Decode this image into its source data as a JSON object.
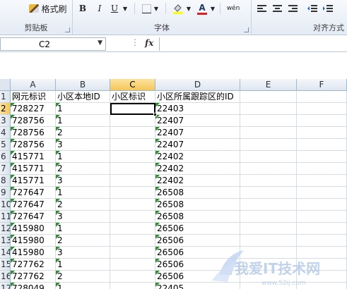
{
  "ribbon": {
    "format_painter_label": "格式刷",
    "bold": "B",
    "italic": "I",
    "underline": "U",
    "font_color_letter": "A",
    "phonetic_label": "wén",
    "groups": {
      "clipboard": "剪贴板",
      "font": "字体",
      "alignment": "对齐方式"
    }
  },
  "formula_bar": {
    "name_box": "C2",
    "fx_label": "fx",
    "formula": ""
  },
  "columns": [
    "A",
    "B",
    "C",
    "D",
    "E",
    "F"
  ],
  "selected_column": "C",
  "selected_row": "2",
  "row_numbers": [
    "1",
    "2",
    "3",
    "4",
    "5",
    "6",
    "7",
    "8",
    "9",
    "10",
    "11",
    "12",
    "13",
    "14",
    "15",
    "16",
    "17"
  ],
  "headers": [
    "网元标识",
    "小区本地ID",
    "小区标识",
    "小区所属跟踪区的ID"
  ],
  "rows": [
    [
      "728227",
      "1",
      "",
      "22403"
    ],
    [
      "728756",
      "1",
      "",
      "22407"
    ],
    [
      "728756",
      "2",
      "",
      "22407"
    ],
    [
      "728756",
      "3",
      "",
      "22407"
    ],
    [
      "415771",
      "1",
      "",
      "22402"
    ],
    [
      "415771",
      "2",
      "",
      "22402"
    ],
    [
      "415771",
      "3",
      "",
      "22402"
    ],
    [
      "727647",
      "1",
      "",
      "26508"
    ],
    [
      "727647",
      "2",
      "",
      "26508"
    ],
    [
      "727647",
      "3",
      "",
      "26508"
    ],
    [
      "415980",
      "1",
      "",
      "26506"
    ],
    [
      "415980",
      "2",
      "",
      "26506"
    ],
    [
      "415980",
      "3",
      "",
      "26506"
    ],
    [
      "727762",
      "1",
      "",
      "26506"
    ],
    [
      "727762",
      "2",
      "",
      "26506"
    ],
    [
      "728049",
      "1",
      "",
      "22405"
    ]
  ],
  "watermark": {
    "text": "我爱IT技术网",
    "url": "www.52ij.com"
  },
  "colors": {
    "error_triangle": "#2f8f2f",
    "selected_header": "#f6c659",
    "font_color_bar": "#e02020",
    "highlight_bar": "#ffff00"
  }
}
